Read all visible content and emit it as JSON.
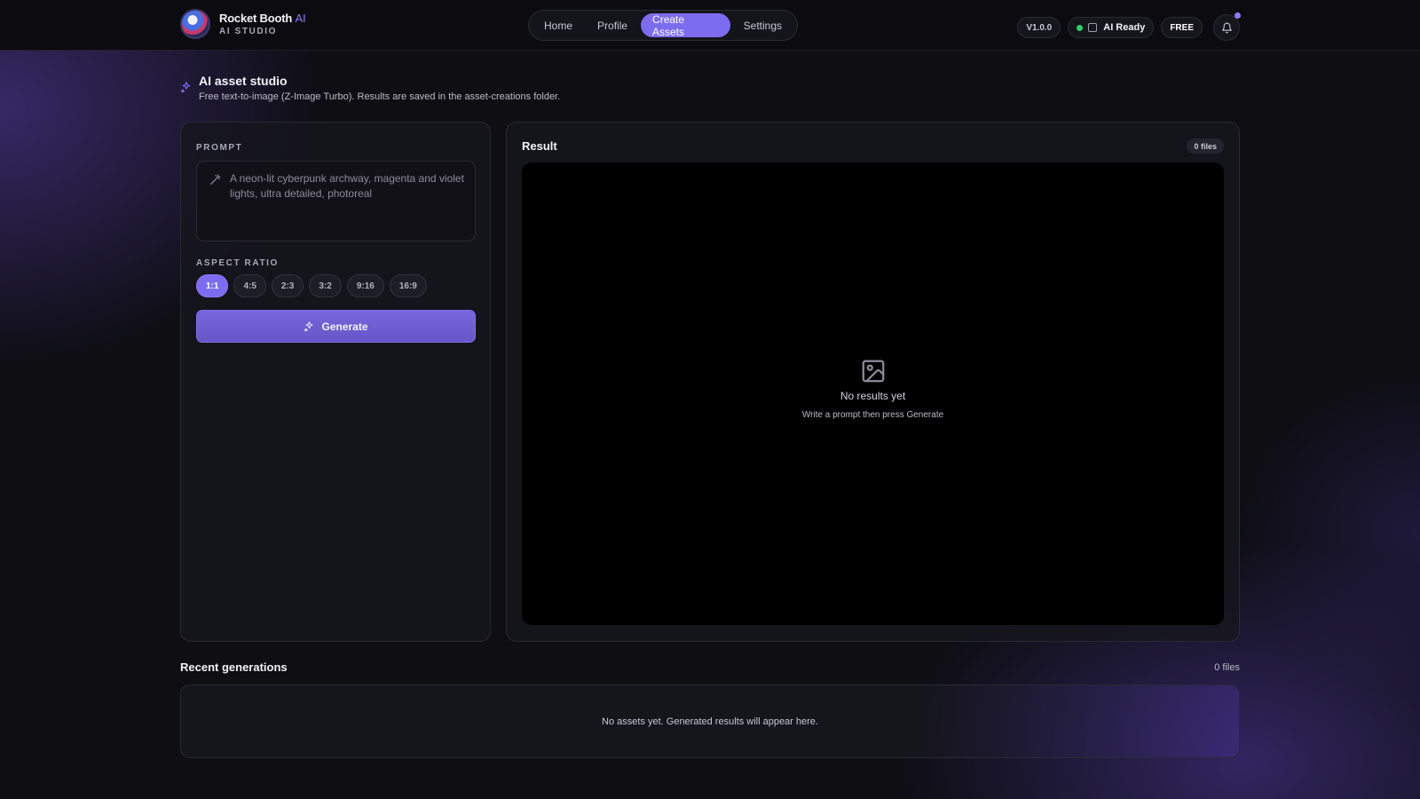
{
  "brand": {
    "title": "Rocket Booth",
    "title_accent": "AI",
    "subtitle": "AI STUDIO"
  },
  "nav": {
    "items": [
      {
        "label": "Home",
        "active": false
      },
      {
        "label": "Profile",
        "active": false
      },
      {
        "label": "Create Assets",
        "active": true
      },
      {
        "label": "Settings",
        "active": false
      }
    ]
  },
  "toolbar": {
    "version": "V1.0.0",
    "ai_status": "AI Ready",
    "plan": "FREE",
    "notification_dot": true
  },
  "header": {
    "title": "AI asset studio",
    "description": "Free text-to-image (Z-Image Turbo). Results are saved in the asset-creations folder."
  },
  "prompt": {
    "label": "PROMPT",
    "placeholder": "A neon-lit cyberpunk archway, magenta and violet lights, ultra detailed, photoreal"
  },
  "aspect_ratio": {
    "label": "ASPECT RATIO",
    "options": [
      "1:1",
      "4:5",
      "2:3",
      "3:2",
      "9:16",
      "16:9"
    ],
    "selected": "1:1"
  },
  "generate_button": "Generate",
  "result": {
    "title": "Result",
    "files": "0 files",
    "empty_title": "No results yet",
    "empty_subtitle": "Write a prompt then press Generate"
  },
  "recent": {
    "title": "Recent generations",
    "count": "0 files",
    "empty": "No assets yet. Generated results will appear here."
  },
  "colors": {
    "accent": "#7c6cf0",
    "status_ok": "#2fcf6a",
    "background": "#0e0e13"
  }
}
